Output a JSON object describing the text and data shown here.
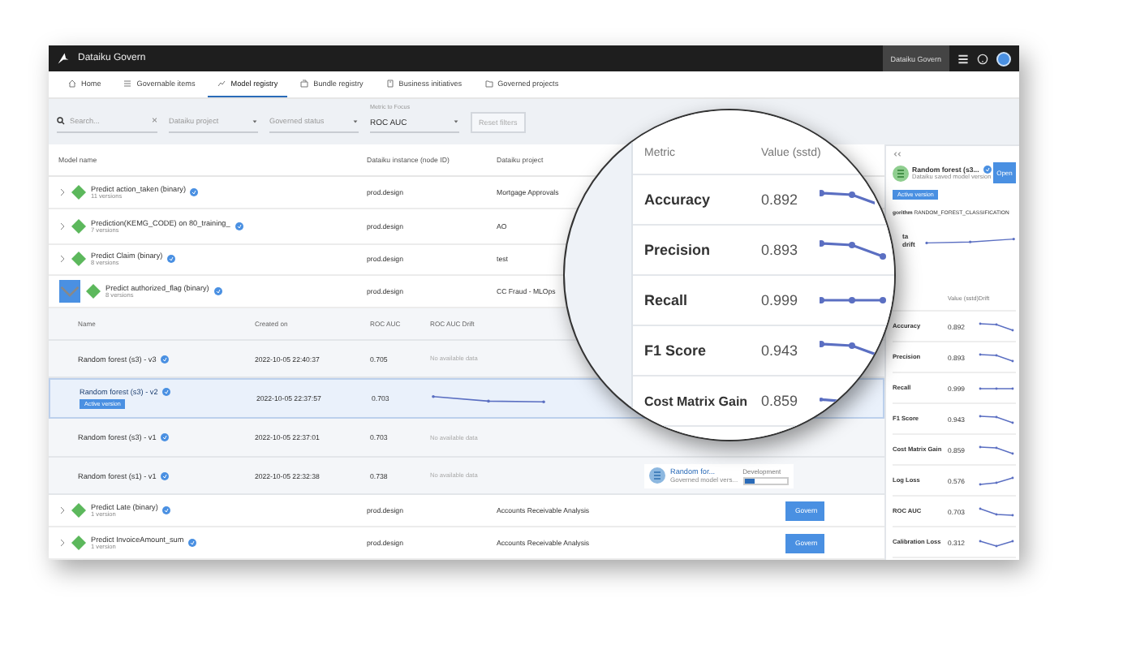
{
  "app": {
    "title": "Dataiku Govern",
    "instance_button": "Dataiku Govern"
  },
  "nav": [
    {
      "label": "Home",
      "selected": false
    },
    {
      "label": "Governable items",
      "selected": false
    },
    {
      "label": "Model registry",
      "selected": true
    },
    {
      "label": "Bundle registry",
      "selected": false
    },
    {
      "label": "Business initiatives",
      "selected": false
    },
    {
      "label": "Governed projects",
      "selected": false
    }
  ],
  "filters": {
    "search": {
      "placeholder": "Search...",
      "clear": "×"
    },
    "dropdowns": [
      {
        "placeholder": "Dataiku project"
      },
      {
        "placeholder": "Governed status"
      },
      {
        "label": "Metric to Focus",
        "value": "ROC AUC"
      }
    ],
    "reset": {
      "label": "Reset filters",
      "disabled": true
    }
  },
  "table": {
    "columns": [
      "Model name",
      "Dataiku instance (node ID)",
      "Dataiku project"
    ],
    "rows": [
      {
        "name": "Predict action_taken (binary)",
        "versions": "11 versions",
        "instance": "prod.design",
        "project": "Mortgage Approvals",
        "expanded": false
      },
      {
        "name": "Prediction(KEMG_CODE) on 80_training_",
        "versions": "7 versions",
        "instance": "prod.design",
        "project": "AO",
        "expanded": false
      },
      {
        "name": "Predict Claim (binary)",
        "versions": "8 versions",
        "instance": "prod.design",
        "project": "test",
        "expanded": false
      },
      {
        "name": "Predict authorized_flag (binary)",
        "versions": "8 versions",
        "instance": "prod.design",
        "project": "CC Fraud - MLOps",
        "expanded": true,
        "children": {
          "columns": [
            "Name",
            "Created on",
            "ROC AUC",
            "ROC AUC Drift"
          ],
          "rows": [
            {
              "name": "Random forest (s3) - v3",
              "created": "2022-10-05 22:40:37",
              "value": "0.705",
              "drift": "No available data",
              "selected": false
            },
            {
              "name": "Random forest (s3) - v2",
              "badge": "Active version",
              "created": "2022-10-05 22:37:57",
              "value": "0.703",
              "selected": true
            },
            {
              "name": "Random forest (s3) - v1",
              "created": "2022-10-05 22:37:01",
              "value": "0.703",
              "drift": "No available data",
              "selected": false
            },
            {
              "name": "Random forest (s1) - v1",
              "created": "2022-10-05 22:32:38",
              "value": "0.738",
              "drift": "No available data",
              "selected": false,
              "card": {
                "title": "Random for...",
                "subtitle": "Governed model vers...",
                "stage": "Development",
                "level": 0.25
              }
            }
          ]
        }
      },
      {
        "name": "Predict Late (binary)",
        "versions": "1 version",
        "instance": "prod.design",
        "project": "Accounts Receivable Analysis",
        "expanded": false,
        "govern": "Govern"
      },
      {
        "name": "Predict InvoiceAmount_sum",
        "versions": "1 version",
        "instance": "prod.design",
        "project": "Accounts Receivable Analysis",
        "expanded": false,
        "govern": "Govern"
      }
    ]
  },
  "side_panel": {
    "title": "Random forest (s3...",
    "subtitle": "Dataiku saved model version",
    "open": "Open",
    "badge": "Active version",
    "algorithm_label": "gorithm",
    "algorithm": "RANDOM_FOREST_CLASSIFICATION",
    "drift_label": "ta drift",
    "columns": [
      "Value (sstd)",
      "Drift"
    ],
    "metrics": [
      {
        "name": "Accuracy",
        "value": "0.892"
      },
      {
        "name": "Precision",
        "value": "0.893"
      },
      {
        "name": "Recall",
        "value": "0.999"
      },
      {
        "name": "F1 Score",
        "value": "0.943"
      },
      {
        "name": "Cost Matrix Gain",
        "value": "0.859"
      },
      {
        "name": "Log Loss",
        "value": "0.576"
      },
      {
        "name": "ROC AUC",
        "value": "0.703"
      },
      {
        "name": "Calibration Loss",
        "value": "0.312"
      }
    ]
  },
  "lens": {
    "columns": [
      "Metric",
      "Value (sstd)"
    ],
    "metrics": [
      {
        "name": "Accuracy",
        "value": "0.892"
      },
      {
        "name": "Precision",
        "value": "0.893"
      },
      {
        "name": "Recall",
        "value": "0.999"
      },
      {
        "name": "F1 Score",
        "value": "0.943"
      },
      {
        "name": "Cost Matrix Gain",
        "value": "0.859"
      }
    ]
  }
}
